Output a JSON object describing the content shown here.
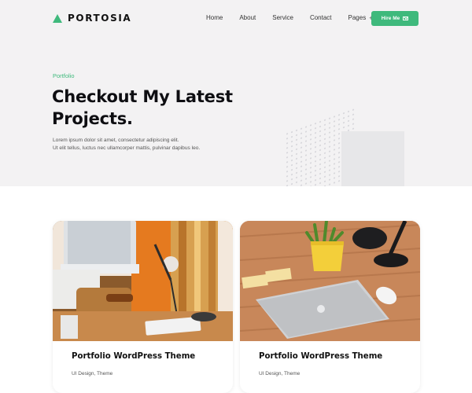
{
  "brand": {
    "name": "PORTOSIA",
    "logo_icon": "triangle-logo-icon",
    "accent_color": "#3fb97c"
  },
  "nav": {
    "items": [
      {
        "label": "Home"
      },
      {
        "label": "About"
      },
      {
        "label": "Service"
      },
      {
        "label": "Contact"
      },
      {
        "label": "Pages",
        "icon": "plus-icon",
        "icon_glyph": "+"
      }
    ],
    "cta": {
      "label": "Hire Me",
      "icon": "mail-icon"
    }
  },
  "hero": {
    "eyebrow": "Portfolio",
    "title_line1": "Checkout My Latest",
    "title_line2": "Projects.",
    "lead_line1": "Lorem ipsum dolor sit amet, consectetur adipiscing elit.",
    "lead_line2": "Ut elit tellus, luctus nec ullamcorper mattis, pulvinar dapibus leo."
  },
  "portfolio": {
    "items": [
      {
        "title": "Portfolio WordPress Theme",
        "tags": "UI Design, Theme",
        "image": "desk-with-imac-photo"
      },
      {
        "title": "Portfolio WordPress Theme",
        "tags": "UI Design, Theme",
        "image": "desk-with-laptop-and-plant-photo"
      }
    ]
  }
}
